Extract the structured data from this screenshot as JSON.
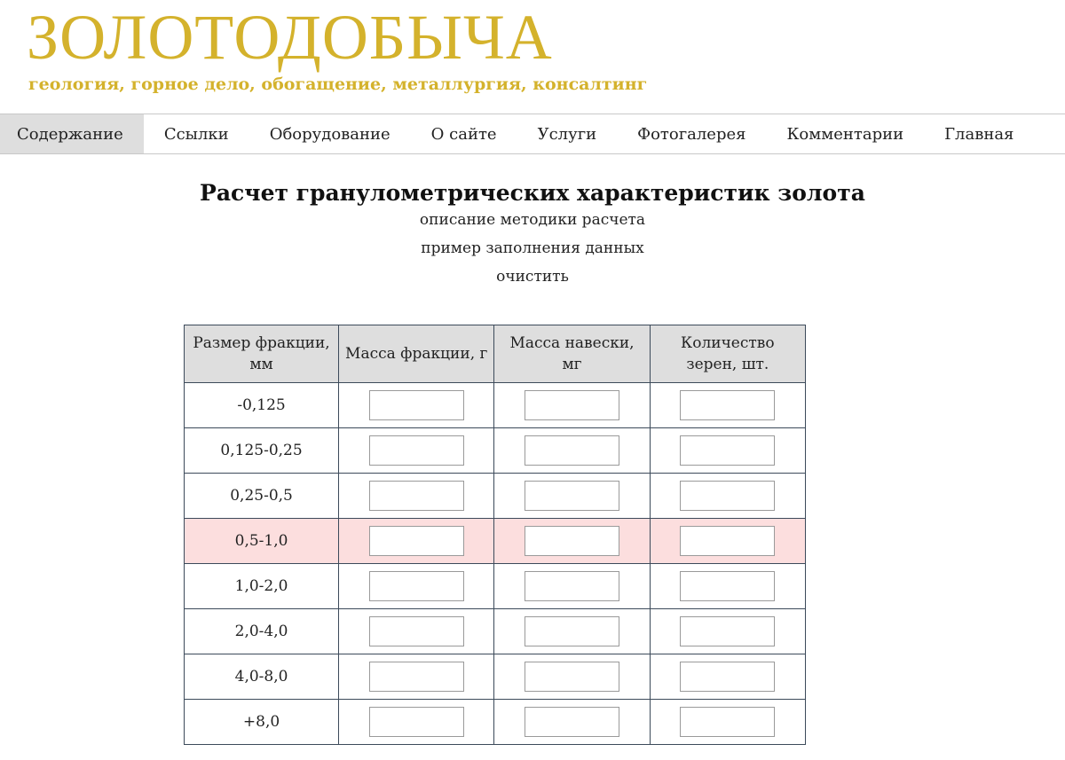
{
  "header": {
    "logo": "ЗОЛОТОДОБЫЧА",
    "tagline": "геология, горное дело, обогащение, металлургия, консалтинг"
  },
  "nav": {
    "items": [
      {
        "label": "Содержание",
        "active": true
      },
      {
        "label": "Ссылки",
        "active": false
      },
      {
        "label": "Оборудование",
        "active": false
      },
      {
        "label": "О сайте",
        "active": false
      },
      {
        "label": "Услуги",
        "active": false
      },
      {
        "label": "Фотогалерея",
        "active": false
      },
      {
        "label": "Комментарии",
        "active": false
      },
      {
        "label": "Главная",
        "active": false
      }
    ]
  },
  "main": {
    "title": "Расчет гранулометрических характеристик золота",
    "links": {
      "method": "описание методики расчета",
      "example": "пример заполнения данных",
      "clear": "очистить"
    }
  },
  "table": {
    "headers": {
      "size_line1": "Размер фракции,",
      "size_line2": "мм",
      "mass": "Масса фракции, г",
      "sample_line1": "Масса навески,",
      "sample_line2": "мг",
      "count_line1": "Количество",
      "count_line2": "зерен, шт."
    },
    "rows": [
      {
        "size": "-0,125",
        "mass": "",
        "sample": "",
        "count": ""
      },
      {
        "size": "0,125-0,25",
        "mass": "",
        "sample": "",
        "count": ""
      },
      {
        "size": "0,25-0,5",
        "mass": "",
        "sample": "",
        "count": ""
      },
      {
        "size": "0,5-1,0",
        "mass": "",
        "sample": "",
        "count": "",
        "highlighted": true
      },
      {
        "size": "1,0-2,0",
        "mass": "",
        "sample": "",
        "count": ""
      },
      {
        "size": "2,0-4,0",
        "mass": "",
        "sample": "",
        "count": ""
      },
      {
        "size": "4,0-8,0",
        "mass": "",
        "sample": "",
        "count": ""
      },
      {
        "size": "+8,0",
        "mass": "",
        "sample": "",
        "count": ""
      }
    ]
  },
  "colors": {
    "brand_gold": "#d4b22c",
    "nav_active_bg": "#dedede",
    "highlight_row": "#fcdede",
    "table_border": "#3c4a5a"
  }
}
